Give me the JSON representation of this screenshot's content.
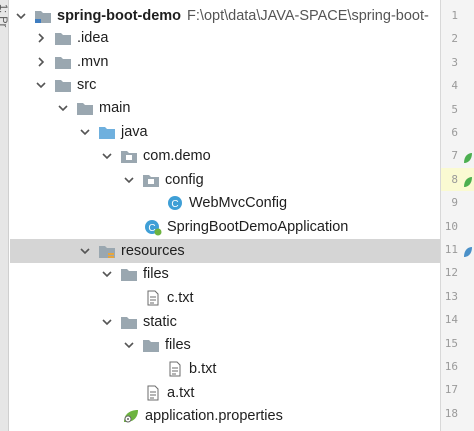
{
  "side_strip": {
    "label": "1: Pr"
  },
  "project": {
    "name": "spring-boot-demo",
    "path": "F:\\opt\\data\\JAVA-SPACE\\spring-boot-"
  },
  "tree": [
    {
      "label": "spring-boot-demo"
    },
    {
      "label": ".idea"
    },
    {
      "label": ".mvn"
    },
    {
      "label": "src"
    },
    {
      "label": "main"
    },
    {
      "label": "java"
    },
    {
      "label": "com.demo"
    },
    {
      "label": "config"
    },
    {
      "label": "WebMvcConfig"
    },
    {
      "label": "SpringBootDemoApplication"
    },
    {
      "label": "resources"
    },
    {
      "label": "files"
    },
    {
      "label": "c.txt"
    },
    {
      "label": "static"
    },
    {
      "label": "files"
    },
    {
      "label": "b.txt"
    },
    {
      "label": "a.txt"
    },
    {
      "label": "application.properties"
    }
  ],
  "gutter": {
    "lines": [
      "1",
      "2",
      "3",
      "4",
      "5",
      "6",
      "7",
      "8",
      "9",
      "10",
      "11",
      "12",
      "13",
      "14",
      "15",
      "16",
      "17",
      "18"
    ],
    "active_line": "8",
    "markers": [
      {
        "line": "7",
        "icon": "spring-bean-icon",
        "color": "#4caf50"
      },
      {
        "line": "8",
        "icon": "spring-bean-icon",
        "color": "#4caf50"
      },
      {
        "line": "11",
        "icon": "spring-bean-icon",
        "color": "#4a90c8"
      }
    ]
  },
  "colors": {
    "selection": "#d5d5d5",
    "folder": "#9aa7b0",
    "source_folder": "#6fb0de",
    "class_icon": "#3f9fd6",
    "spring_green": "#6db33f",
    "resources_marker": "#e8a53b"
  }
}
